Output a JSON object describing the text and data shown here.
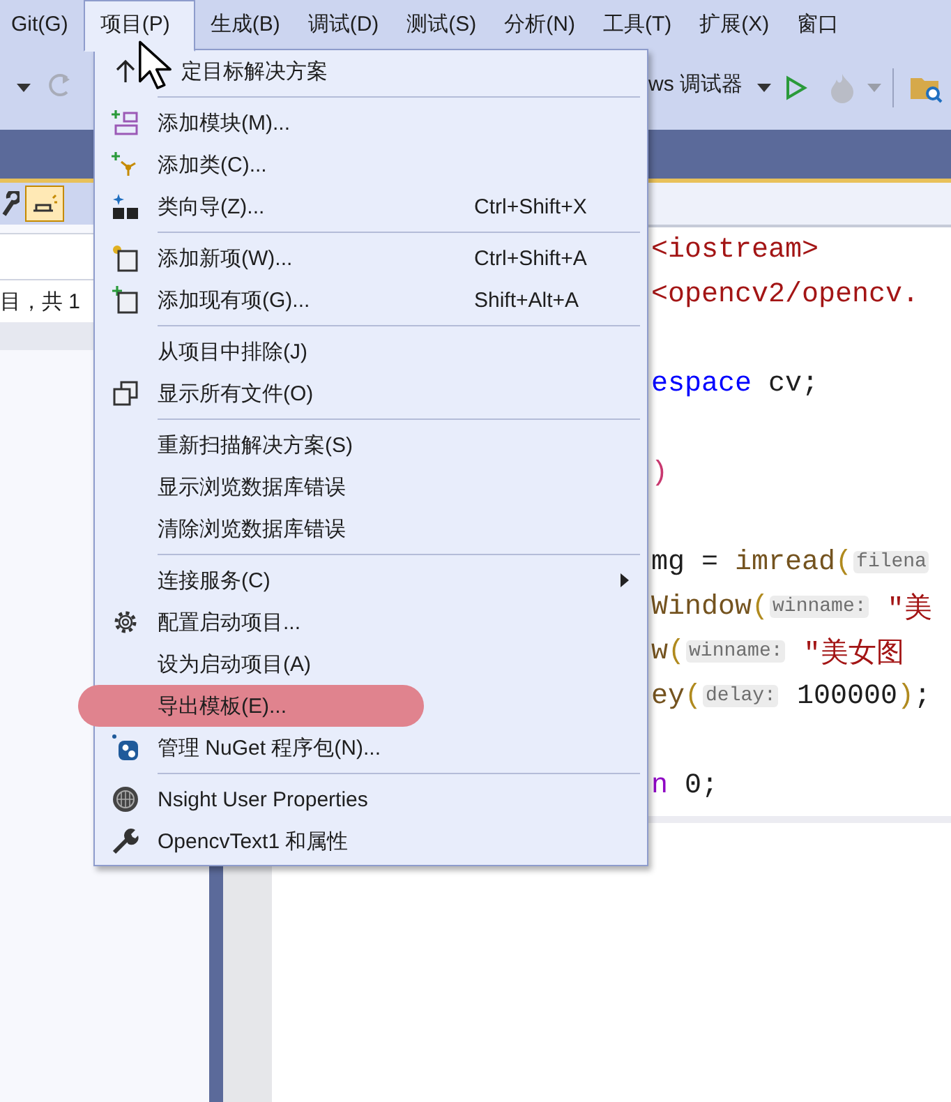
{
  "menubar": [
    {
      "label": "Git(G)",
      "selected": false
    },
    {
      "label": "项目(P)",
      "selected": true
    },
    {
      "label": "生成(B)",
      "selected": false
    },
    {
      "label": "调试(D)",
      "selected": false
    },
    {
      "label": "测试(S)",
      "selected": false
    },
    {
      "label": "分析(N)",
      "selected": false
    },
    {
      "label": "工具(T)",
      "selected": false
    },
    {
      "label": "扩展(X)",
      "selected": false
    },
    {
      "label": "窗口",
      "selected": false
    }
  ],
  "toolbar": {
    "debugger_label": "ws 调试器"
  },
  "left_panel": {
    "status_text": "目，共 1"
  },
  "menu": {
    "items": [
      {
        "kind": "item",
        "label": "定目标解决方案"
      },
      {
        "kind": "separator"
      },
      {
        "kind": "item",
        "label": "添加模块(M)..."
      },
      {
        "kind": "item",
        "label": "添加类(C)..."
      },
      {
        "kind": "item",
        "label": "类向导(Z)...",
        "shortcut": "Ctrl+Shift+X"
      },
      {
        "kind": "separator"
      },
      {
        "kind": "item",
        "label": "添加新项(W)...",
        "shortcut": "Ctrl+Shift+A"
      },
      {
        "kind": "item",
        "label": "添加现有项(G)...",
        "shortcut": "Shift+Alt+A"
      },
      {
        "kind": "separator"
      },
      {
        "kind": "item",
        "label": "从项目中排除(J)"
      },
      {
        "kind": "item",
        "label": "显示所有文件(O)"
      },
      {
        "kind": "separator"
      },
      {
        "kind": "item",
        "label": "重新扫描解决方案(S)"
      },
      {
        "kind": "item",
        "label": "显示浏览数据库错误"
      },
      {
        "kind": "item",
        "label": "清除浏览数据库错误"
      },
      {
        "kind": "separator"
      },
      {
        "kind": "item",
        "label": "连接服务(C)",
        "submenu": true
      },
      {
        "kind": "item",
        "label": "配置启动项目..."
      },
      {
        "kind": "item",
        "label": "设为启动项目(A)"
      },
      {
        "kind": "item",
        "label": "导出模板(E)...",
        "highlighted": true
      },
      {
        "kind": "item",
        "label": "管理 NuGet 程序包(N)..."
      },
      {
        "kind": "separator"
      },
      {
        "kind": "item",
        "label": "Nsight User Properties"
      },
      {
        "kind": "item",
        "label": "OpencvText1 和属性"
      }
    ]
  },
  "code": {
    "lines": [
      {
        "kind": "code",
        "segments": [
          {
            "kind": "string",
            "text": "<iostream>"
          }
        ]
      },
      {
        "kind": "code",
        "segments": [
          {
            "kind": "string",
            "text": "<opencv2/opencv."
          }
        ]
      },
      {
        "kind": "blank"
      },
      {
        "kind": "code",
        "segments": [
          {
            "kind": "keyword",
            "text": "espace"
          },
          {
            "kind": "plain",
            "text": " cv;"
          }
        ]
      },
      {
        "kind": "blank"
      },
      {
        "kind": "code",
        "segments": [
          {
            "kind": "macro",
            "text": ")"
          }
        ]
      },
      {
        "kind": "blank"
      },
      {
        "kind": "code",
        "segments": [
          {
            "kind": "plain",
            "text": "mg = "
          },
          {
            "kind": "function",
            "text": "imread"
          },
          {
            "kind": "paren",
            "text": "("
          },
          {
            "kind": "hint",
            "text": "filena"
          }
        ]
      },
      {
        "kind": "code",
        "segments": [
          {
            "kind": "function",
            "text": "Window"
          },
          {
            "kind": "paren",
            "text": "("
          },
          {
            "kind": "hint",
            "text": "winname:"
          },
          {
            "kind": "string",
            "text": " ″美"
          }
        ]
      },
      {
        "kind": "code",
        "segments": [
          {
            "kind": "function",
            "text": "w"
          },
          {
            "kind": "paren",
            "text": "("
          },
          {
            "kind": "hint",
            "text": "winname:"
          },
          {
            "kind": "string",
            "text": " ″美女图"
          }
        ]
      },
      {
        "kind": "code",
        "segments": [
          {
            "kind": "function",
            "text": "ey"
          },
          {
            "kind": "paren",
            "text": "("
          },
          {
            "kind": "hint",
            "text": "delay:"
          },
          {
            "kind": "plain",
            "text": " 100000"
          },
          {
            "kind": "paren",
            "text": ")"
          },
          {
            "kind": "plain",
            "text": ";"
          }
        ]
      },
      {
        "kind": "blank"
      },
      {
        "kind": "code",
        "segments": [
          {
            "kind": "control",
            "text": "n"
          },
          {
            "kind": "plain",
            "text": " 0;"
          }
        ]
      }
    ]
  }
}
